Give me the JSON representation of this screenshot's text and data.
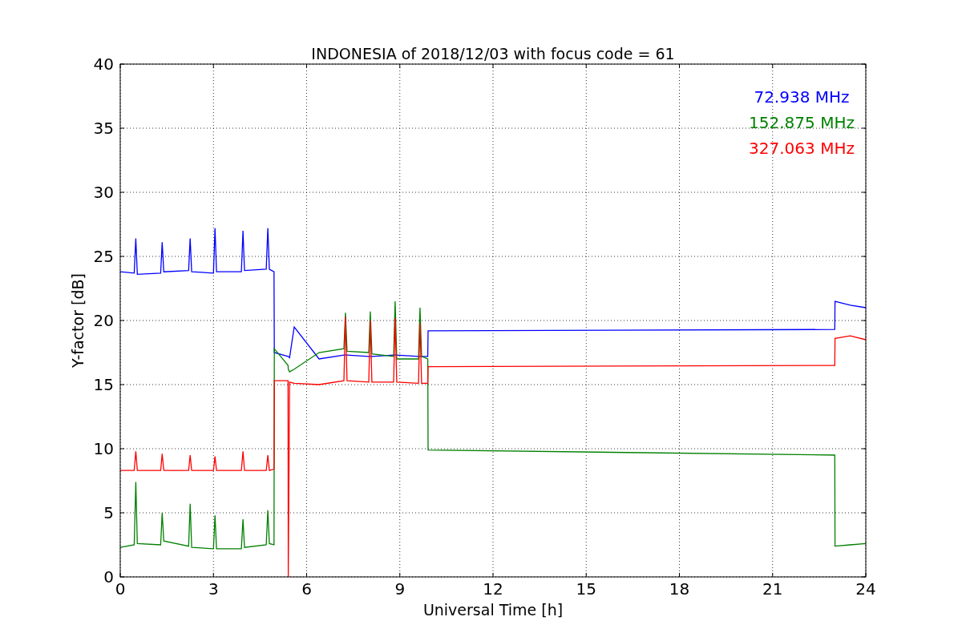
{
  "figure": {
    "chart_data": {
      "type": "line",
      "title": "INDONESIA of 2018/12/03 with focus code = 61",
      "xlabel": "Universal Time [h]",
      "ylabel": "Y-factor [dB]",
      "x": [
        0,
        0.45,
        0.5,
        0.55,
        1.3,
        1.35,
        1.4,
        2.2,
        2.25,
        2.3,
        3.0,
        3.05,
        3.1,
        3.9,
        3.95,
        4.0,
        4.7,
        4.75,
        4.8,
        4.95,
        4.96,
        5.4,
        5.41,
        5.45,
        5.6,
        6.4,
        7.2,
        7.25,
        7.3,
        8.0,
        8.05,
        8.1,
        8.8,
        8.85,
        8.9,
        9.6,
        9.65,
        9.7,
        9.9,
        9.91,
        23.0,
        23.01,
        23.5,
        24
      ],
      "series": [
        {
          "name": "72.938 MHz",
          "color": "#0000ff",
          "values": [
            23.8,
            23.7,
            26.4,
            23.6,
            23.7,
            26.1,
            23.8,
            23.9,
            26.4,
            23.8,
            23.7,
            27.2,
            23.8,
            23.8,
            27,
            23.9,
            24,
            27.2,
            24,
            23.8,
            17.5,
            17.2,
            17.2,
            17.1,
            19.5,
            17.0,
            17.3,
            17.3,
            17.3,
            17.2,
            17.2,
            17.2,
            17.3,
            17.3,
            17.3,
            17.2,
            17.2,
            17.2,
            17.2,
            19.2,
            19.3,
            21.5,
            21.2,
            21.0
          ]
        },
        {
          "name": "152.875 MHz",
          "color": "#008000",
          "values": [
            2.3,
            2.5,
            7.4,
            2.6,
            2.5,
            5.0,
            2.8,
            2.4,
            5.7,
            2.3,
            2.2,
            4.8,
            2.2,
            2.2,
            4.5,
            2.3,
            2.5,
            5.2,
            2.6,
            2.5,
            17.8,
            16.5,
            16.2,
            16.0,
            16.2,
            17.5,
            17.8,
            20.6,
            17.6,
            17.5,
            20.7,
            17.4,
            17.2,
            21.5,
            17.0,
            17.0,
            21.0,
            17.2,
            17.0,
            9.9,
            9.5,
            2.4,
            2.5,
            2.6
          ]
        },
        {
          "name": "327.063 MHz",
          "color": "#ff0000",
          "values": [
            8.3,
            8.3,
            9.8,
            8.3,
            8.3,
            9.6,
            8.3,
            8.3,
            9.5,
            8.3,
            8.3,
            9.4,
            8.3,
            8.3,
            9.8,
            8.3,
            8.3,
            9.5,
            8.3,
            8.4,
            15.3,
            15.3,
            0,
            15.2,
            15.1,
            15.0,
            15.3,
            20.3,
            15.3,
            15.2,
            20.0,
            15.2,
            15.2,
            20.2,
            15.2,
            15.1,
            19.8,
            15.1,
            15.1,
            16.4,
            16.5,
            18.6,
            18.8,
            18.5
          ]
        }
      ],
      "xlim": [
        0,
        24
      ],
      "ylim": [
        0,
        40
      ],
      "xticks": [
        0,
        3,
        6,
        9,
        12,
        15,
        18,
        21,
        24
      ],
      "yticks": [
        0,
        5,
        10,
        15,
        20,
        25,
        30,
        35,
        40
      ],
      "grid": true
    }
  }
}
